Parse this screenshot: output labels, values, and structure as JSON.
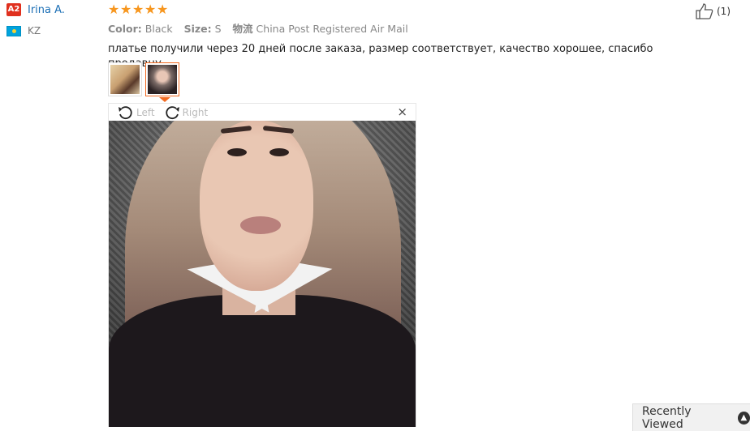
{
  "reviewer": {
    "level_badge": "A2",
    "name": "Irina A.",
    "country_code": "KZ",
    "flag_icon": "flag-kz-icon"
  },
  "review": {
    "rating_stars": 5,
    "color_label": "Color:",
    "color_value": "Black",
    "size_label": "Size:",
    "size_value": "S",
    "shipping_label": "物流",
    "shipping_value": "China Post Registered Air Mail",
    "text": "платье получили через 20 дней после заказа, размер соответствует, качество хорошее, спасибо продавцу"
  },
  "helpful": {
    "icon": "thumbs-up-icon",
    "count": "(1)"
  },
  "gallery": {
    "thumbnails": [
      "thumbnail-1",
      "thumbnail-2"
    ],
    "active_index": 1
  },
  "viewer": {
    "rotate_left_label": "Left",
    "rotate_right_label": "Right",
    "close_symbol": "×"
  },
  "recently_viewed": {
    "label": "Recently Viewed",
    "icon": "chevron-up-icon"
  },
  "colors": {
    "accent": "#f26a21",
    "star": "#f7961e",
    "link": "#1a6eb5",
    "badge": "#e0301e"
  }
}
